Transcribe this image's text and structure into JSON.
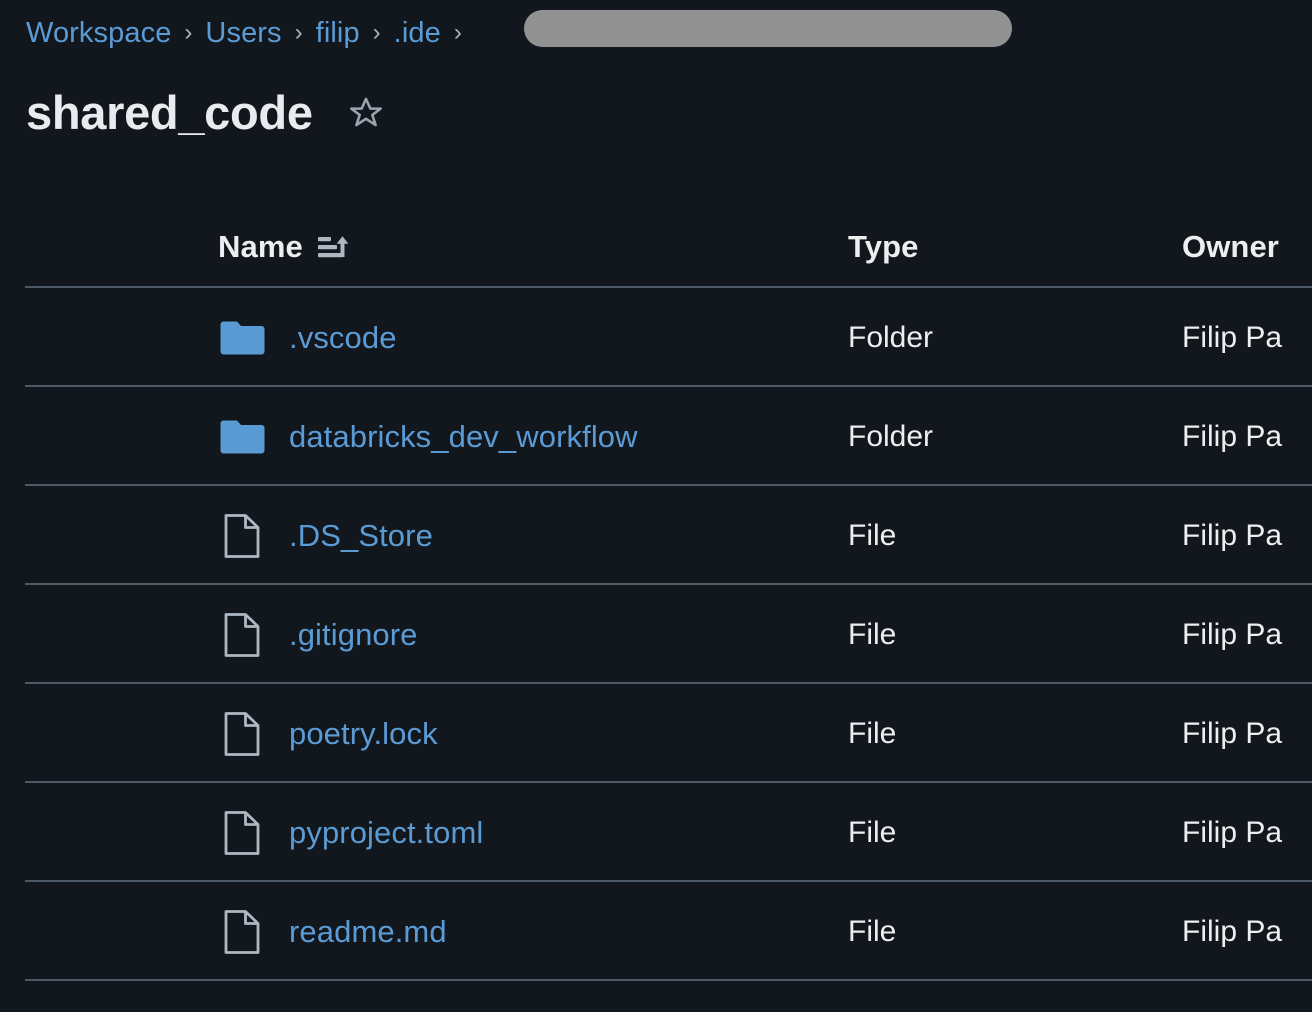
{
  "colors": {
    "background": "#11171c",
    "link": "#5b9bd5",
    "text": "#eceef0",
    "divider": "#4d5965",
    "folder": "#5b9bd5",
    "file_icon": "#aeb8c2",
    "star": "#9aa5b1",
    "chevron": "#a9b4be",
    "redaction": "#919191"
  },
  "breadcrumb": {
    "separator": "›",
    "items": [
      {
        "label": "Workspace",
        "redacted": false
      },
      {
        "label": "Users",
        "redacted": false
      },
      {
        "label": "filip",
        "redacted": true
      },
      {
        "label": ".ide",
        "redacted": false
      }
    ],
    "trailing_separator": "›"
  },
  "header": {
    "title": "shared_code",
    "favorite_icon": "star-outline-icon",
    "favorited": false
  },
  "table": {
    "sort": {
      "column": "Name",
      "direction": "ascending",
      "icon": "sort-ascending-icon"
    },
    "columns": [
      {
        "key": "name",
        "label": "Name"
      },
      {
        "key": "type",
        "label": "Type"
      },
      {
        "key": "owner",
        "label": "Owner"
      }
    ],
    "rows": [
      {
        "icon": "folder-icon",
        "name": ".vscode",
        "type": "Folder",
        "owner": "Filip Pa"
      },
      {
        "icon": "folder-icon",
        "name": "databricks_dev_workflow",
        "type": "Folder",
        "owner": "Filip Pa"
      },
      {
        "icon": "file-icon",
        "name": ".DS_Store",
        "type": "File",
        "owner": "Filip Pa"
      },
      {
        "icon": "file-icon",
        "name": ".gitignore",
        "type": "File",
        "owner": "Filip Pa"
      },
      {
        "icon": "file-icon",
        "name": "poetry.lock",
        "type": "File",
        "owner": "Filip Pa"
      },
      {
        "icon": "file-icon",
        "name": "pyproject.toml",
        "type": "File",
        "owner": "Filip Pa"
      },
      {
        "icon": "file-icon",
        "name": "readme.md",
        "type": "File",
        "owner": "Filip Pa"
      }
    ]
  }
}
